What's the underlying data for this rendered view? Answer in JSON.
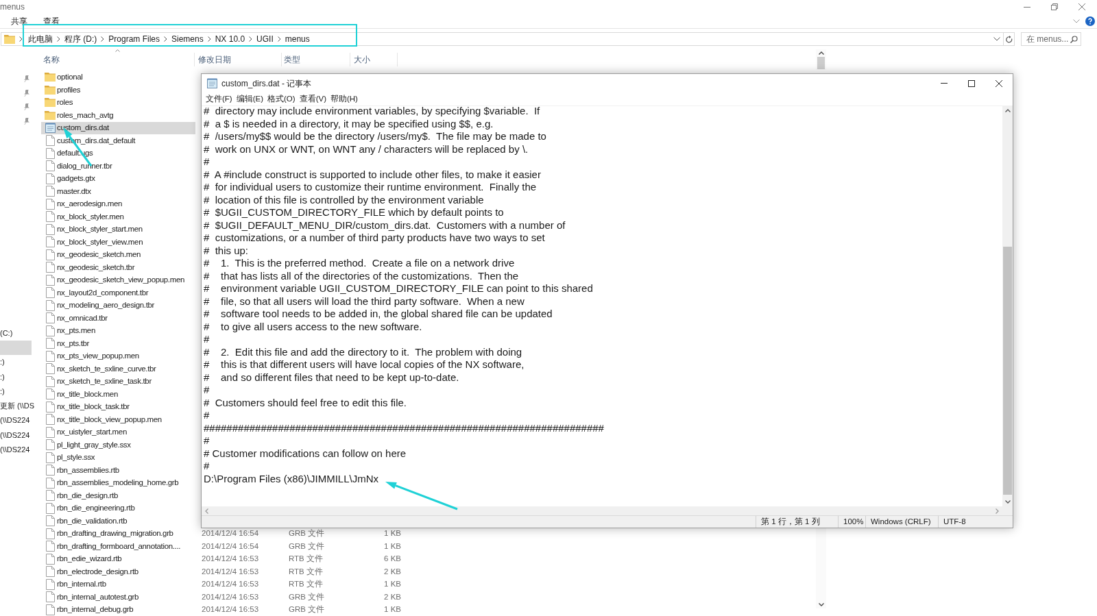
{
  "explorer": {
    "title": "menus",
    "ribbon_tabs": [
      "共享",
      "查看"
    ],
    "breadcrumb": [
      "此电脑",
      "程序 (D:)",
      "Program Files",
      "Siemens",
      "NX 10.0",
      "UGII",
      "menus"
    ],
    "search": {
      "placeholder": "在 menus..."
    },
    "columns": [
      "名称",
      "修改日期",
      "类型",
      "大小"
    ],
    "nav_items": [
      {
        "label": "(C:)",
        "selected": false
      },
      {
        "selected": true
      },
      {
        "label": ":)",
        "selected": false
      },
      {
        "label": ":)",
        "selected": false
      },
      {
        "label": ":)",
        "selected": false
      },
      {
        "label": "更新 (\\\\DS",
        "selected": false
      },
      {
        "label": "(\\\\DS224",
        "selected": false
      },
      {
        "label": "(\\\\DS224",
        "selected": false
      },
      {
        "label": "(\\\\DS224",
        "selected": false
      }
    ],
    "files": [
      {
        "name": "optional",
        "kind": "folder",
        "selected": false
      },
      {
        "name": "profiles",
        "kind": "folder",
        "selected": false
      },
      {
        "name": "roles",
        "kind": "folder",
        "selected": false
      },
      {
        "name": "roles_mach_avtg",
        "kind": "folder",
        "selected": false
      },
      {
        "name": "custom_dirs.dat",
        "kind": "text",
        "selected": true
      },
      {
        "name": "custom_dirs.dat_default",
        "kind": "file",
        "selected": false
      },
      {
        "name": "default.ugs",
        "kind": "file",
        "selected": false
      },
      {
        "name": "dialog_runner.tbr",
        "kind": "file",
        "selected": false
      },
      {
        "name": "gadgets.gtx",
        "kind": "file",
        "selected": false
      },
      {
        "name": "master.dtx",
        "kind": "file",
        "selected": false
      },
      {
        "name": "nx_aerodesign.men",
        "kind": "file",
        "selected": false
      },
      {
        "name": "nx_block_styler.men",
        "kind": "file",
        "selected": false
      },
      {
        "name": "nx_block_styler_start.men",
        "kind": "file",
        "selected": false
      },
      {
        "name": "nx_block_styler_view.men",
        "kind": "file",
        "selected": false
      },
      {
        "name": "nx_geodesic_sketch.men",
        "kind": "file",
        "selected": false
      },
      {
        "name": "nx_geodesic_sketch.tbr",
        "kind": "file",
        "selected": false
      },
      {
        "name": "nx_geodesic_sketch_view_popup.men",
        "kind": "file",
        "selected": false
      },
      {
        "name": "nx_layout2d_component.tbr",
        "kind": "file",
        "selected": false
      },
      {
        "name": "nx_modeling_aero_design.tbr",
        "kind": "file",
        "selected": false
      },
      {
        "name": "nx_omnicad.tbr",
        "kind": "file",
        "selected": false
      },
      {
        "name": "nx_pts.men",
        "kind": "file",
        "selected": false
      },
      {
        "name": "nx_pts.tbr",
        "kind": "file",
        "selected": false
      },
      {
        "name": "nx_pts_view_popup.men",
        "kind": "file",
        "selected": false
      },
      {
        "name": "nx_sketch_te_sxline_curve.tbr",
        "kind": "file",
        "selected": false
      },
      {
        "name": "nx_sketch_te_sxline_task.tbr",
        "kind": "file",
        "selected": false
      },
      {
        "name": "nx_title_block.men",
        "kind": "file",
        "selected": false
      },
      {
        "name": "nx_title_block_task.tbr",
        "kind": "file",
        "selected": false
      },
      {
        "name": "nx_title_block_view_popup.men",
        "kind": "file",
        "selected": false
      },
      {
        "name": "nx_uistyler_start.men",
        "kind": "file",
        "selected": false
      },
      {
        "name": "pl_light_gray_style.ssx",
        "kind": "file",
        "selected": false
      },
      {
        "name": "pl_style.ssx",
        "kind": "file",
        "selected": false
      },
      {
        "name": "rbn_assemblies.rtb",
        "kind": "file",
        "selected": false
      },
      {
        "name": "rbn_assemblies_modeling_home.grb",
        "kind": "file",
        "selected": false
      },
      {
        "name": "rbn_die_design.rtb",
        "kind": "file",
        "selected": false
      },
      {
        "name": "rbn_die_engineering.rtb",
        "kind": "file",
        "selected": false
      },
      {
        "name": "rbn_die_validation.rtb",
        "kind": "file",
        "selected": false
      },
      {
        "name": "rbn_drafting_drawing_migration.grb",
        "kind": "file",
        "selected": false,
        "date": "2014/12/4 16:54",
        "type": "GRB 文件",
        "size": "1 KB"
      },
      {
        "name": "rbn_drafting_formboard_annotation....",
        "kind": "file",
        "selected": false,
        "date": "2014/12/4 16:54",
        "type": "GRB 文件",
        "size": "1 KB"
      },
      {
        "name": "rbn_edie_wizard.rtb",
        "kind": "file",
        "selected": false,
        "date": "2014/12/4 16:53",
        "type": "RTB 文件",
        "size": "6 KB"
      },
      {
        "name": "rbn_electrode_design.rtb",
        "kind": "file",
        "selected": false,
        "date": "2014/12/4 16:53",
        "type": "RTB 文件",
        "size": "2 KB"
      },
      {
        "name": "rbn_internal.rtb",
        "kind": "file",
        "selected": false,
        "date": "2014/12/4 16:53",
        "type": "RTB 文件",
        "size": "1 KB"
      },
      {
        "name": "rbn_internal_autotest.grb",
        "kind": "file",
        "selected": false,
        "date": "2014/12/4 16:53",
        "type": "GRB 文件",
        "size": "2 KB"
      },
      {
        "name": "rbn_internal_debug.grb",
        "kind": "file",
        "selected": false,
        "date": "2014/12/4 16:53",
        "type": "GRB 文件",
        "size": "1 KB"
      }
    ]
  },
  "notepad": {
    "title": "custom_dirs.dat - 记事本",
    "menu": [
      "文件(F)",
      "编辑(E)",
      "格式(O)",
      "查看(V)",
      "帮助(H)"
    ],
    "lines": [
      "#  directory may include environment variables, by specifying $variable.  If",
      "#  a $ is needed in a directory, it may be specified using $$, e.g.",
      "#  /users/my$$ would be the directory /users/my$.  The file may be made to",
      "#  work on UNX or WNT, on WNT any / characters will be replaced by \\.",
      "#",
      "#  A #include construct is supported to include other files, to make it easier",
      "#  for individual users to customize their runtime environment.  Finally the",
      "#  location of this file is controlled by the environment variable",
      "#  $UGII_CUSTOM_DIRECTORY_FILE which by default points to",
      "#  $UGII_DEFAULT_MENU_DIR/custom_dirs.dat.  Customers with a number of",
      "#  customizations, or a number of third party products have two ways to set",
      "#  this up:",
      "#    1.  This is the preferred method.  Create a file on a network drive",
      "#    that has lists all of the directories of the customizations.  Then the",
      "#    environment variable UGII_CUSTOM_DIRECTORY_FILE can point to this shared",
      "#    file, so that all users will load the third party software.  When a new",
      "#    software tool needs to be added in, the global shared file can be updated",
      "#    to give all users access to the new software.",
      "#",
      "#    2.  Edit this file and add the directory to it.  The problem with doing",
      "#    this is that different users will have local copies of the NX software,",
      "#    and so different files that need to be kept up-to-date.",
      "#",
      "#  Customers should feel free to edit this file.",
      "#",
      "######################################################################",
      "#",
      "# Customer modifications can follow on here",
      "#",
      "D:\\Program Files (x86)\\JIMMILL\\JmNx"
    ],
    "status": {
      "position": "第 1 行，第 1 列",
      "zoom": "100%",
      "line_ending": "Windows (CRLF)",
      "encoding": "UTF-8"
    }
  }
}
